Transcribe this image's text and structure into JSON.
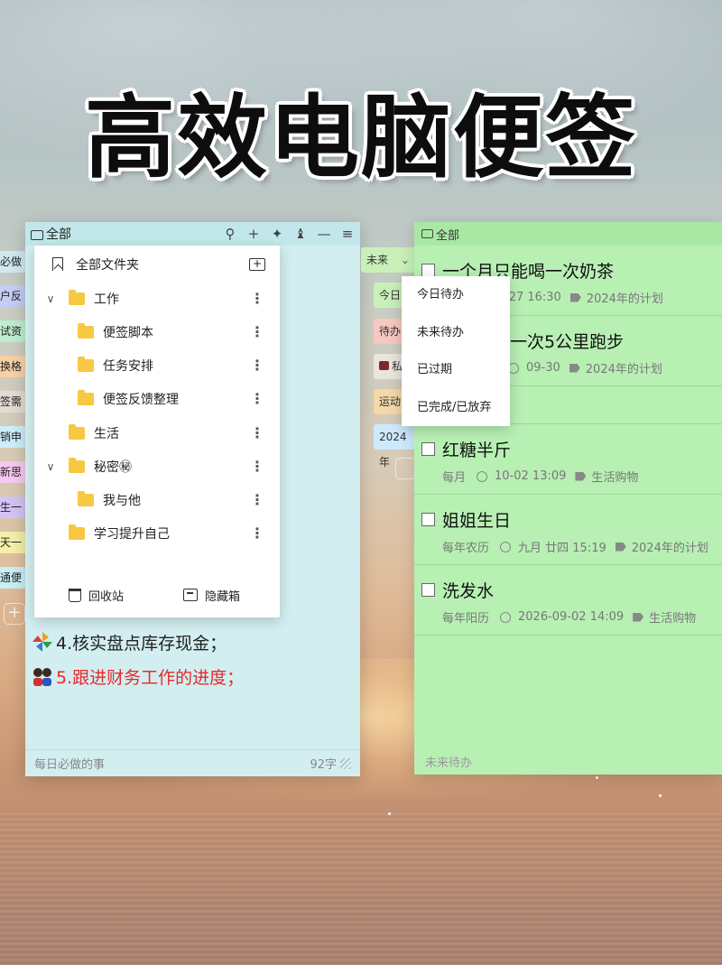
{
  "headline": "高效电脑便签",
  "left_peek_tags": [
    {
      "text": "必做",
      "color": "#cfe9ef"
    },
    {
      "text": "户反",
      "color": "#c4cdf5"
    },
    {
      "text": "试资",
      "color": "#bfeecf"
    },
    {
      "text": "换格",
      "color": "#f7d2a8"
    },
    {
      "text": "签需",
      "color": "#e3dcd2"
    },
    {
      "text": "销申",
      "color": "#cdeefa"
    },
    {
      "text": "新思",
      "color": "#f7c8ef"
    },
    {
      "text": "生一",
      "color": "#d2c4f5"
    },
    {
      "text": "天一",
      "color": "#f4f0a8"
    },
    {
      "text": "通便",
      "color": "#c8f0f6"
    }
  ],
  "left_window": {
    "title": "全部",
    "toolbar_icons": [
      "search-icon",
      "plus-icon",
      "pin-icon",
      "shirt-icon",
      "minimize-icon",
      "menu-icon"
    ],
    "lines": [
      {
        "text": "4.核实盘点库存现金；",
        "color": "#222222"
      },
      {
        "text": "5.跟进财务工作的进度；",
        "color": "#e8282b"
      }
    ],
    "footer_label": "每日必做的事",
    "char_count": "92字"
  },
  "folder_popup": {
    "all_folders": "全部文件夹",
    "folders": [
      {
        "label": "工作",
        "level": 0,
        "expanded": true
      },
      {
        "label": "便签脚本",
        "level": 1,
        "expanded": null
      },
      {
        "label": "任务安排",
        "level": 1,
        "expanded": null
      },
      {
        "label": "便签反馈整理",
        "level": 1,
        "expanded": null
      },
      {
        "label": "生活",
        "level": 0,
        "expanded": null
      },
      {
        "label": "秘密㊙",
        "level": 0,
        "expanded": true
      },
      {
        "label": "我与他",
        "level": 1,
        "expanded": null
      },
      {
        "label": "学习提升自己",
        "level": 0,
        "expanded": null
      }
    ],
    "recycle_bin": "回收站",
    "hidden_box": "隐藏箱"
  },
  "middle_tags": {
    "dropdown_value": "未来",
    "tags": [
      {
        "text": "今日",
        "color": "#c9f0b8"
      },
      {
        "text": "待办",
        "color": "#f6c8c2"
      },
      {
        "text": "私",
        "color": "#e9e4de"
      },
      {
        "text": "运动",
        "color": "#f4d8a8"
      },
      {
        "text": "2024年",
        "color": "#cdeafc"
      }
    ]
  },
  "right_window": {
    "title": "全部",
    "tasks": [
      {
        "title": "一个月只能喝一次奶茶",
        "repeat": "",
        "date": "-27 16:30",
        "tag": "2024年的计划"
      },
      {
        "title": "一次5公里跑步",
        "repeat": "",
        "date": "09-30",
        "tag": "2024年的计划"
      },
      {
        "title": "",
        "repeat": "",
        "date": "",
        "tag": ""
      },
      {
        "title": "红糖半斤",
        "repeat": "每月",
        "date": "10-02 13:09",
        "tag": "生活购物"
      },
      {
        "title": "姐姐生日",
        "repeat": "每年农历",
        "date": "九月 廿四 15:19",
        "tag": "2024年的计划"
      },
      {
        "title": "洗发水",
        "repeat": "每年阳历",
        "date": "2026-09-02 14:09",
        "tag": "生活购物"
      }
    ],
    "footer_label": "未来待办"
  },
  "dropdown_menu": {
    "items": [
      "今日待办",
      "未来待办",
      "已过期",
      "已完成/已放弃"
    ]
  }
}
